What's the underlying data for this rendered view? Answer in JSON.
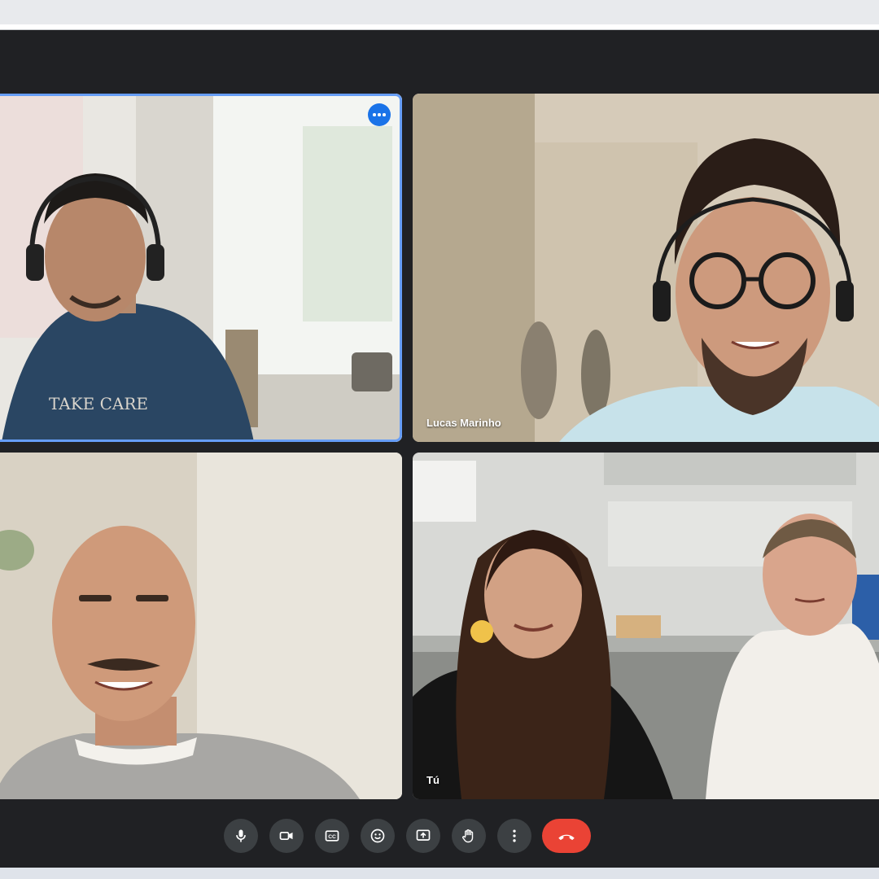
{
  "participants": [
    {
      "name": "",
      "active_speaker": true
    },
    {
      "name": "Lucas Marinho",
      "active_speaker": false
    },
    {
      "name": "",
      "active_speaker": false
    },
    {
      "name": "Tú",
      "active_speaker": false
    }
  ],
  "tile_menu_icon": "more-horizontal-icon",
  "controls": [
    {
      "icon": "microphone-icon",
      "action": "Toggle microphone"
    },
    {
      "icon": "camera-icon",
      "action": "Toggle camera"
    },
    {
      "icon": "captions-icon",
      "action": "Captions"
    },
    {
      "icon": "emoji-icon",
      "action": "Reactions"
    },
    {
      "icon": "present-screen-icon",
      "action": "Present"
    },
    {
      "icon": "raise-hand-icon",
      "action": "Raise hand"
    },
    {
      "icon": "more-vertical-icon",
      "action": "More options"
    },
    {
      "icon": "end-call-icon",
      "action": "Leave call"
    }
  ],
  "colors": {
    "background": "#202124",
    "control_button": "#3c4043",
    "leave_button": "#ea4335",
    "active_border": "#669df6",
    "menu_button": "#1a73e8"
  }
}
